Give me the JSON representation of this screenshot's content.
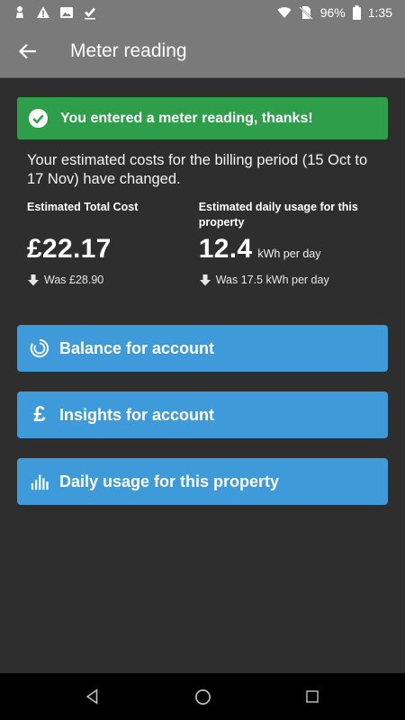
{
  "status_bar": {
    "icons_left": [
      "notification-icon",
      "warning-icon",
      "image-icon",
      "download-icon"
    ],
    "icons_right": [
      "wifi-icon",
      "no-sim-icon",
      "battery-icon"
    ],
    "battery": "96%",
    "time": "1:35"
  },
  "app_bar": {
    "title": "Meter reading"
  },
  "banner": {
    "text": "You entered a meter reading, thanks!"
  },
  "summary": "Your estimated costs for the billing period (15 Oct to 17 Nov) have changed.",
  "stats": {
    "cost": {
      "label": "Estimated Total Cost",
      "value": "£22.17",
      "was": "Was £28.90"
    },
    "usage": {
      "label": "Estimated daily usage for this property",
      "value": "12.4",
      "unit": "kWh per day",
      "was": "Was 17.5 kWh per day"
    }
  },
  "buttons": [
    {
      "label": "Balance for account",
      "icon": "balance-icon"
    },
    {
      "label": "Insights for account",
      "icon": "pound-icon"
    },
    {
      "label": "Daily usage for this property",
      "icon": "bar-chart-icon"
    }
  ],
  "colors": {
    "app_bar": "#7a7a7a",
    "background": "#2e2e2e",
    "banner": "#2e9e4a",
    "button": "#3e9ad8"
  }
}
